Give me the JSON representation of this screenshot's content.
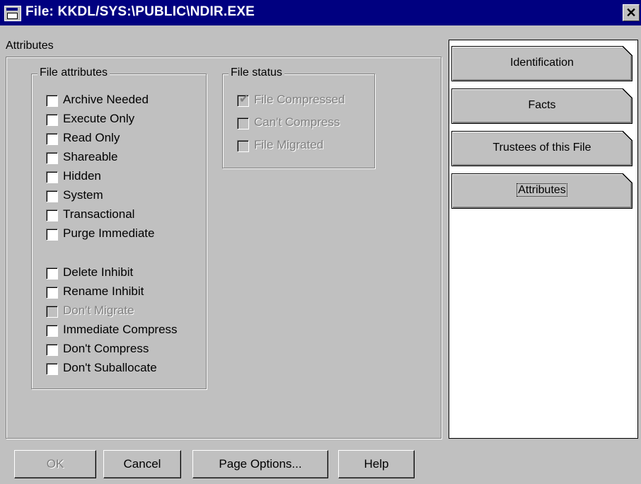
{
  "window": {
    "title": "File: KKDL/SYS:\\PUBLIC\\NDIR.EXE",
    "icon": "file-properties-icon",
    "close_label": "✕"
  },
  "panel": {
    "caption": "Attributes"
  },
  "file_attributes": {
    "legend": "File attributes",
    "items": [
      {
        "label": "Archive Needed",
        "checked": false,
        "enabled": true
      },
      {
        "label": "Execute Only",
        "checked": false,
        "enabled": true
      },
      {
        "label": "Read Only",
        "checked": false,
        "enabled": true
      },
      {
        "label": "Shareable",
        "checked": false,
        "enabled": true
      },
      {
        "label": "Hidden",
        "checked": false,
        "enabled": true
      },
      {
        "label": "System",
        "checked": false,
        "enabled": true
      },
      {
        "label": "Transactional",
        "checked": false,
        "enabled": true
      },
      {
        "label": "Purge Immediate",
        "checked": false,
        "enabled": true
      },
      {
        "label": "Delete Inhibit",
        "checked": false,
        "enabled": true
      },
      {
        "label": "Rename Inhibit",
        "checked": false,
        "enabled": true
      },
      {
        "label": "Don't Migrate",
        "checked": false,
        "enabled": false
      },
      {
        "label": "Immediate Compress",
        "checked": false,
        "enabled": true
      },
      {
        "label": "Don't Compress",
        "checked": false,
        "enabled": true
      },
      {
        "label": "Don't Suballocate",
        "checked": false,
        "enabled": true
      }
    ]
  },
  "file_status": {
    "legend": "File status",
    "items": [
      {
        "label": "File Compressed",
        "checked": true,
        "enabled": false
      },
      {
        "label": "Can't Compress",
        "checked": false,
        "enabled": false
      },
      {
        "label": "File Migrated",
        "checked": false,
        "enabled": false
      }
    ]
  },
  "tabs": [
    {
      "label": "Identification",
      "active": false
    },
    {
      "label": "Facts",
      "active": false
    },
    {
      "label": "Trustees of this File",
      "active": false
    },
    {
      "label": "Attributes",
      "active": true
    }
  ],
  "buttons": {
    "ok": "OK",
    "cancel": "Cancel",
    "page_options": "Page Options...",
    "help": "Help"
  }
}
